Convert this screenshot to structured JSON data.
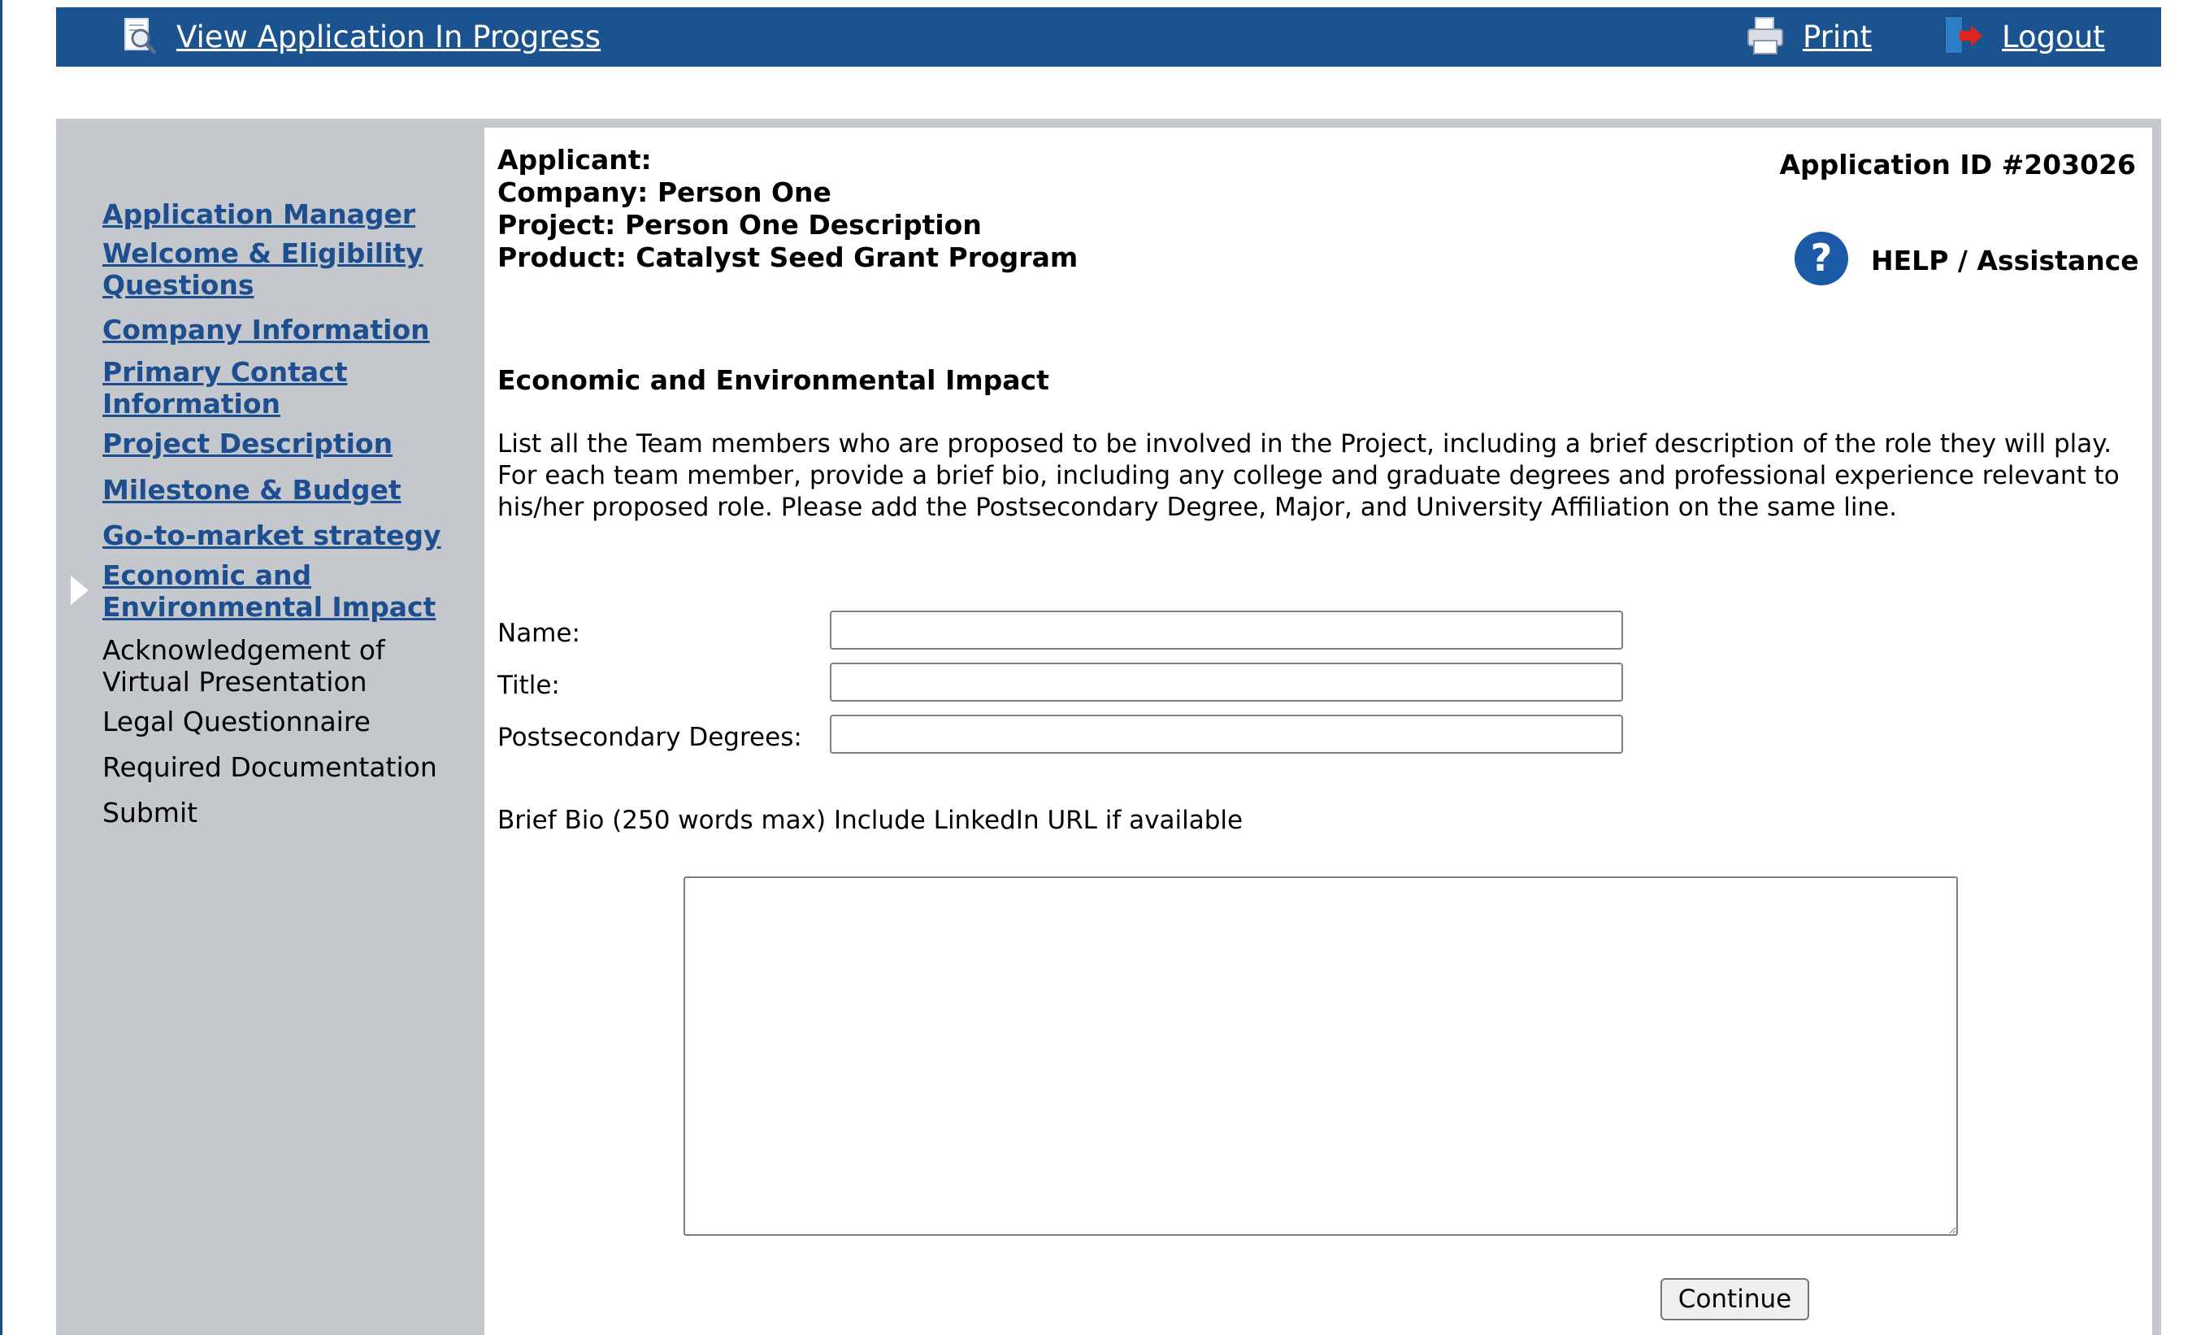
{
  "topbar": {
    "view_label": "View Application In Progress",
    "print_label": "Print",
    "logout_label": "Logout"
  },
  "sidebar": {
    "items": [
      {
        "label": "Application Manager",
        "link": true
      },
      {
        "label": "Welcome & Eligibility Questions",
        "link": true
      },
      {
        "label": "Company Information",
        "link": true
      },
      {
        "label": "Primary Contact Information",
        "link": true
      },
      {
        "label": "Project Description",
        "link": true
      },
      {
        "label": "Milestone & Budget",
        "link": true
      },
      {
        "label": "Go-to-market strategy",
        "link": true
      },
      {
        "label": "Economic and Environmental Impact",
        "link": true,
        "current": true
      },
      {
        "label": "Acknowledgement of Virtual Presentation",
        "link": false
      },
      {
        "label": "Legal Questionnaire",
        "link": false
      },
      {
        "label": "Required Documentation",
        "link": false
      },
      {
        "label": "Submit",
        "link": false
      }
    ]
  },
  "header": {
    "applicant": "Applicant:",
    "company": "Company: Person One",
    "project": "Project: Person One Description",
    "product": "Product: Catalyst Seed Grant Program",
    "application_id": "Application ID #203026",
    "help_label": "HELP / Assistance",
    "help_icon_glyph": "?"
  },
  "section": {
    "title": "Economic and Environmental Impact",
    "instructions": "List all the Team members who are proposed to be involved in the Project, including a brief description of the role they will play. For each team member, provide a brief bio, including any college and graduate degrees and professional experience relevant to his/her proposed role. Please add the Postsecondary Degree, Major, and University Affiliation on the same line."
  },
  "form": {
    "name_label": "Name:",
    "title_label": "Title:",
    "degrees_label": "Postsecondary Degrees:",
    "bio_label": "Brief Bio (250 words max) Include LinkedIn URL if available",
    "name_value": "",
    "title_value": "",
    "degrees_value": "",
    "bio_value": "",
    "continue_label": "Continue"
  },
  "colors": {
    "topbar": "#1b5390",
    "link": "#1d4e8f",
    "sidebar": "#c4c8cc",
    "help_icon": "#1a5aa6"
  }
}
